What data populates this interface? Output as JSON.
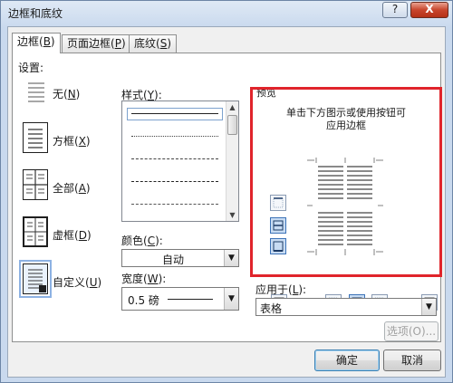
{
  "window": {
    "title": "边框和底纹",
    "help_label": "?",
    "close_label": "X"
  },
  "tabs": [
    {
      "label": "边框(",
      "key": "B",
      "suffix": ")"
    },
    {
      "label": "页面边框(",
      "key": "P",
      "suffix": ")"
    },
    {
      "label": "底纹(",
      "key": "S",
      "suffix": ")"
    }
  ],
  "settings": {
    "heading": "设置:",
    "items": [
      {
        "label": "无(",
        "key": "N",
        "suffix": ")"
      },
      {
        "label": "方框(",
        "key": "X",
        "suffix": ")"
      },
      {
        "label": "全部(",
        "key": "A",
        "suffix": ")"
      },
      {
        "label": "虚框(",
        "key": "D",
        "suffix": ")"
      },
      {
        "label": "自定义(",
        "key": "U",
        "suffix": ")"
      }
    ],
    "selected": "自定义"
  },
  "style": {
    "heading": "样式(",
    "key": "Y",
    "suffix": "):",
    "line_styles": [
      "solid",
      "dotted-fine",
      "dashed-fine",
      "dashed",
      "dash-dot"
    ]
  },
  "color": {
    "heading": "颜色(",
    "key": "C",
    "suffix": "):",
    "value": "自动"
  },
  "width": {
    "heading": "宽度(",
    "key": "W",
    "suffix": "):",
    "value": "0.5 磅"
  },
  "preview": {
    "heading": "预览",
    "instructions_line1": "单击下方图示或使用按钮可",
    "instructions_line2": "应用边框"
  },
  "apply_to": {
    "heading": "应用于(",
    "key": "L",
    "suffix": "):",
    "value": "表格"
  },
  "buttons": {
    "options": "选项(O)...",
    "ok": "确定",
    "cancel": "取消"
  },
  "colors": {
    "highlight": "#e0242b",
    "selection": "#8db2e3"
  }
}
